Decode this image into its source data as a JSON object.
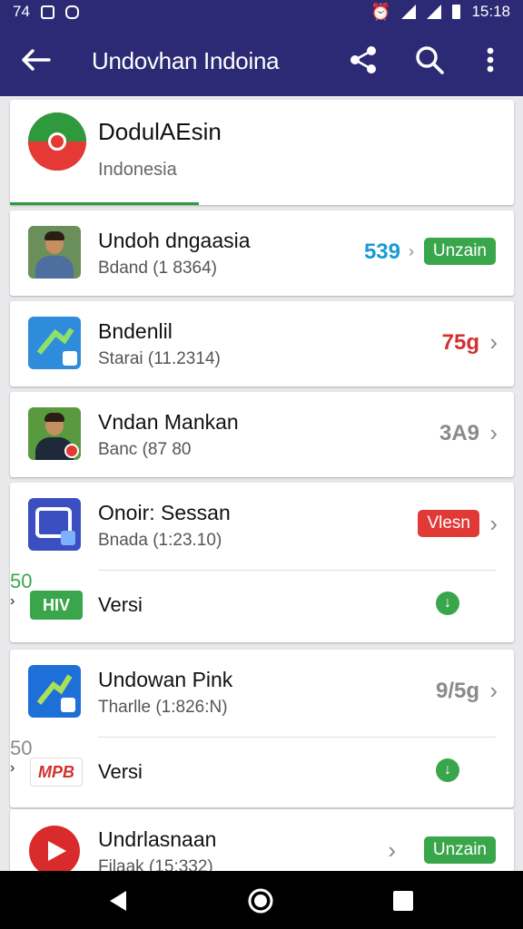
{
  "status_bar": {
    "left_text": "74",
    "time": "15:18"
  },
  "app_bar": {
    "title": "Undovhan Indoina"
  },
  "hero": {
    "title": "DodulAEsin",
    "subtitle": "Indonesia"
  },
  "rows": [
    {
      "name": "Undoh dngaasia",
      "meta": "Bdand (1 8364)",
      "value": "539",
      "value_color": "#1a9bd6",
      "badge": "Unzain",
      "badge_color": "#3aa64b"
    },
    {
      "name": "Bndenlil",
      "meta": "Starai (11.2314)",
      "value": "75g",
      "value_color": "#d3302f"
    },
    {
      "name": "Vndan Mankan",
      "meta": "Banc (87 80",
      "value": "3A9",
      "value_color": "#8a8a8a"
    },
    {
      "name": "Onoir: Sessan",
      "meta": "Bnada (1:23.10)",
      "badge": "Vlesn",
      "badge_color": "#e13a36"
    },
    {
      "name": "Undowan Pink",
      "meta": "Tharlle (1:826:N)",
      "value": "9/5g",
      "value_color": "#8a8a8a"
    },
    {
      "name": "Undrlasnaan",
      "meta": "Filaak (15:332)",
      "badge": "Unzain",
      "badge_color": "#3aa64b"
    }
  ],
  "sub_rows": [
    {
      "icon_text": "HIV",
      "label": "Versi",
      "value": "50",
      "value_color": "#3aa64b"
    },
    {
      "icon_text": "MPB",
      "label": "Versi",
      "value": "50",
      "value_color": "#8a8a8a"
    }
  ],
  "icons": {
    "back": "arrow-left-icon",
    "share": "share-icon",
    "search": "search-icon",
    "menu": "more-vert-icon",
    "nav_back": "nav-back-icon",
    "nav_home": "nav-home-icon",
    "nav_recent": "nav-recents-icon"
  },
  "colors": {
    "primary": "#2c2a74",
    "green": "#3aa64b",
    "red": "#e13a36",
    "blue": "#1a9bd6"
  }
}
